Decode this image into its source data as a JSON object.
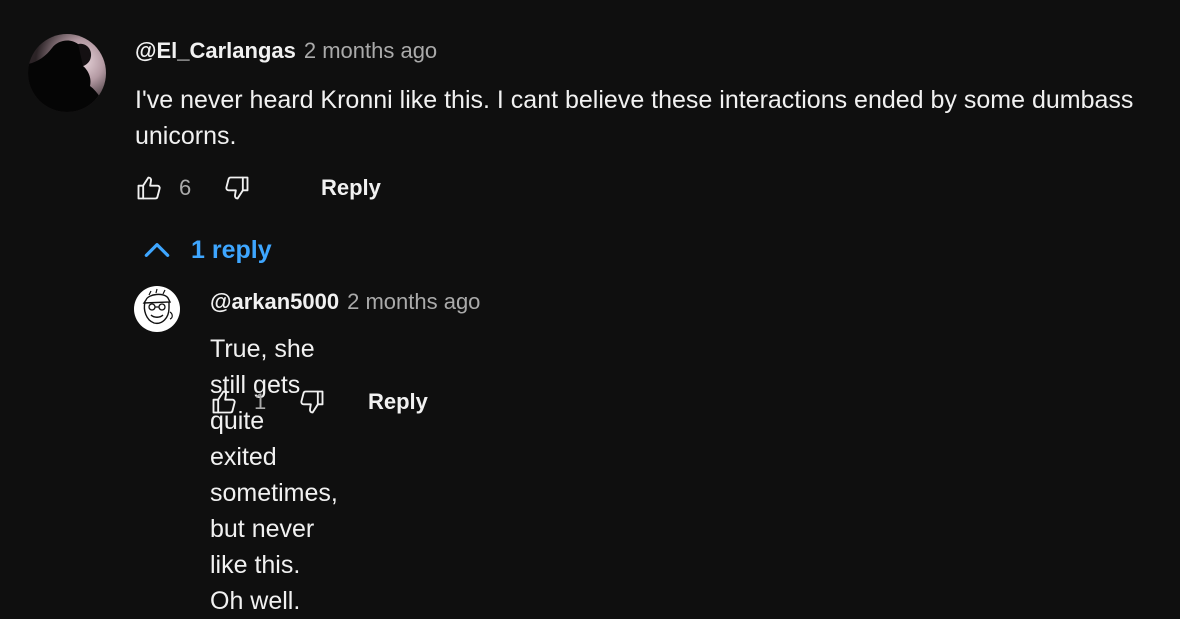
{
  "comments": [
    {
      "author": "@El_Carlangas",
      "time": "2 months ago",
      "text": "I've never heard Kronni like this. I cant believe these interactions ended by some dumbass unicorns.",
      "likes": "6",
      "reply_label": "Reply",
      "avatar_icon": "silhouette-avatar-icon"
    }
  ],
  "replies_toggle": {
    "label": "1 reply",
    "icon": "chevron-up-icon",
    "color": "#3ea6ff"
  },
  "replies": [
    {
      "author": "@arkan5000",
      "time": "2 months ago",
      "text": "True, she still gets quite exited sometimes, but never like this. Oh well.",
      "likes": "1",
      "reply_label": "Reply",
      "avatar_icon": "sketch-face-avatar-icon"
    }
  ],
  "colors": {
    "background": "#0f0f0f",
    "text": "#f1f1f1",
    "secondary": "#aaaaaa",
    "link": "#3ea6ff"
  }
}
